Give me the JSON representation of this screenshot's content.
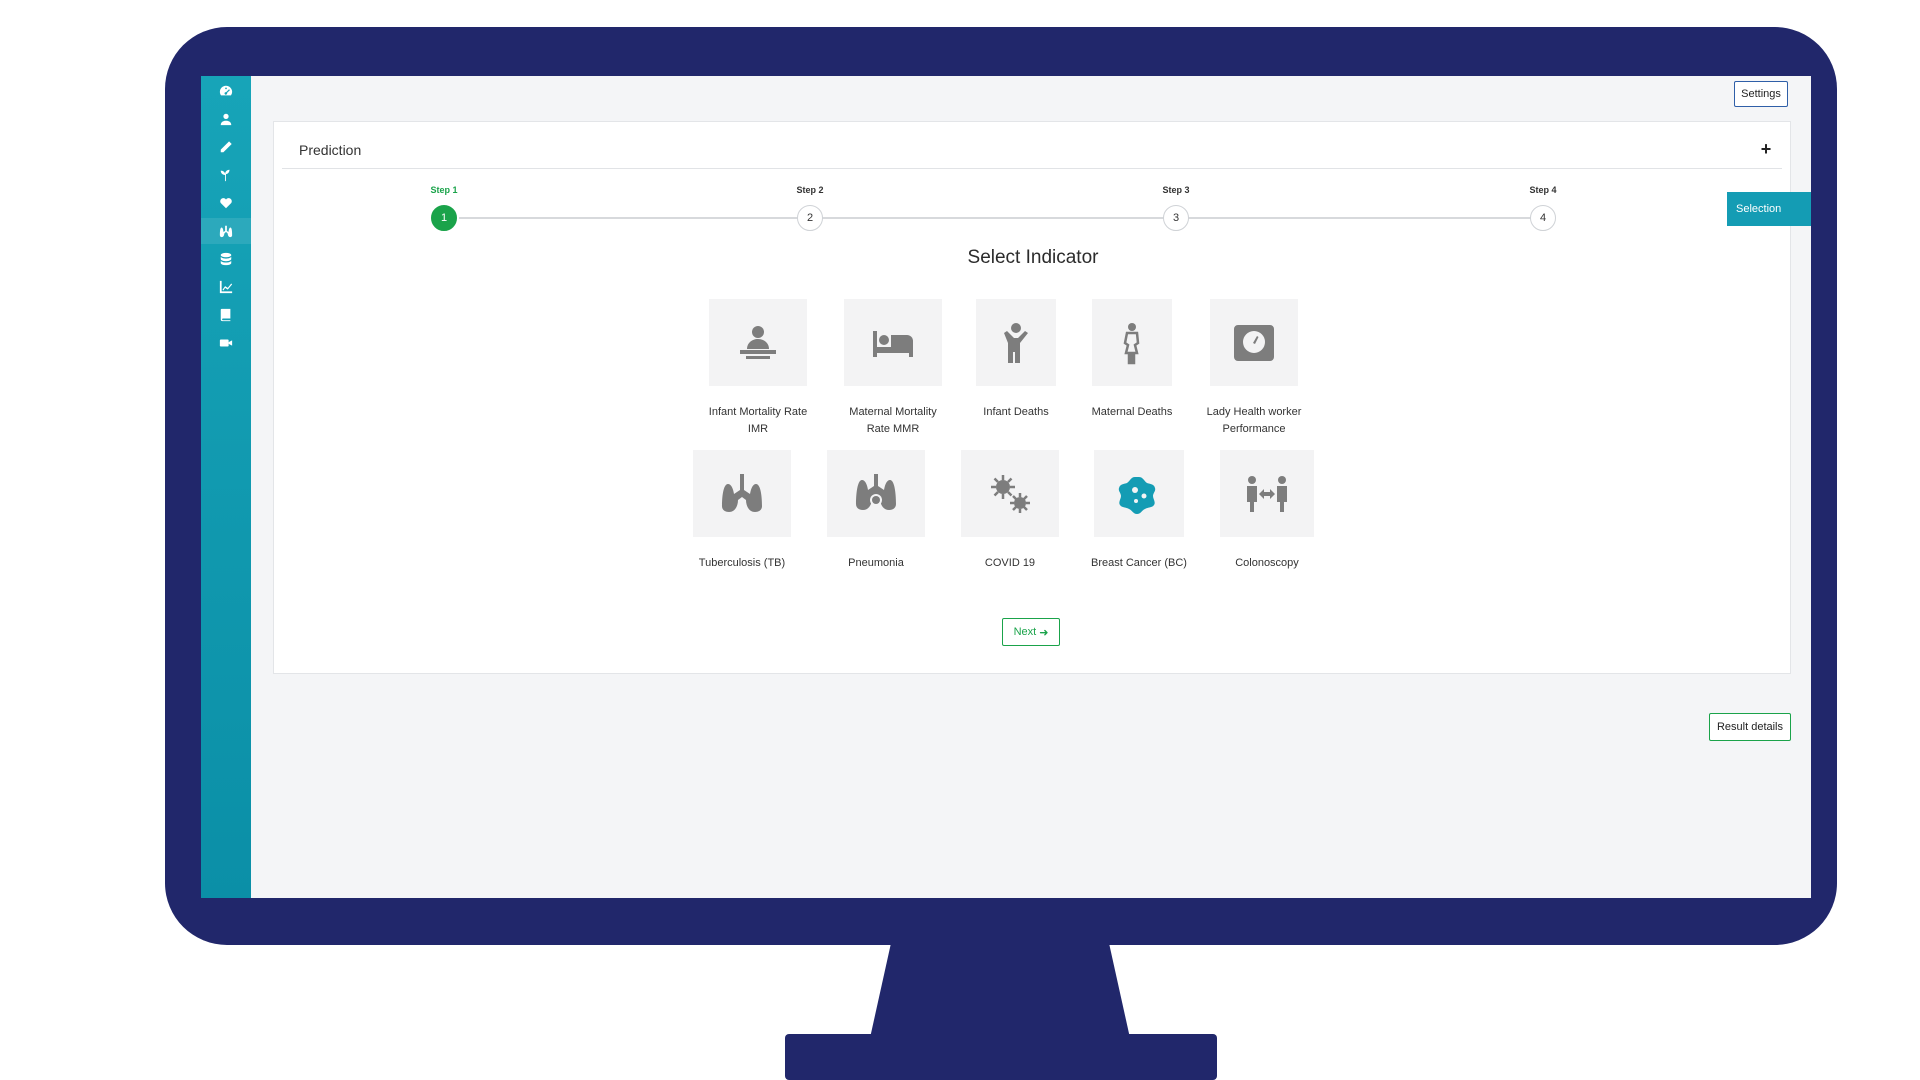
{
  "header": {
    "settings_label": "Settings"
  },
  "card": {
    "title": "Prediction",
    "add_icon": "plus-icon"
  },
  "stepper": {
    "steps": [
      {
        "label": "Step 1",
        "number": "1",
        "active": true
      },
      {
        "label": "Step 2",
        "number": "2",
        "active": false
      },
      {
        "label": "Step 3",
        "number": "3",
        "active": false
      },
      {
        "label": "Step 4",
        "number": "4",
        "active": false
      }
    ]
  },
  "selection_tab": "Selection",
  "section_title": "Select Indicator",
  "indicators": [
    {
      "label_line1": "Infant Mortality Rate",
      "label_line2": "IMR",
      "icon": "infant-care-icon"
    },
    {
      "label_line1": "Maternal Mortality",
      "label_line2": "Rate MMR",
      "icon": "bed-icon"
    },
    {
      "label_line1": "Infant Deaths",
      "label_line2": "",
      "icon": "child-icon"
    },
    {
      "label_line1": "Maternal Deaths",
      "label_line2": "",
      "icon": "woman-icon"
    },
    {
      "label_line1": "Lady Health worker",
      "label_line2": "Performance",
      "icon": "weight-scale-icon"
    },
    {
      "label_line1": "Tuberculosis (TB)",
      "label_line2": "",
      "icon": "lungs-icon"
    },
    {
      "label_line1": "Pneumonia",
      "label_line2": "",
      "icon": "lungs-virus-icon"
    },
    {
      "label_line1": "COVID 19",
      "label_line2": "",
      "icon": "virus-icon"
    },
    {
      "label_line1": "Breast Cancer (BC)",
      "label_line2": "",
      "icon": "cell-icon"
    },
    {
      "label_line1": "Colonoscopy",
      "label_line2": "",
      "icon": "people-arrows-icon"
    }
  ],
  "buttons": {
    "next_label": "Next",
    "result_details_label": "Result details"
  },
  "sidebar_icons": [
    "dashboard-icon",
    "user-icon",
    "pencil-icon",
    "plant-icon",
    "heart-icon",
    "lungs-icon",
    "database-icon",
    "chart-icon",
    "book-icon",
    "video-icon"
  ],
  "colors": {
    "monitor": "#21276b",
    "sidebar": "#149cb4",
    "accent_green": "#1aa34a",
    "selected_icon": "#149cb4"
  }
}
